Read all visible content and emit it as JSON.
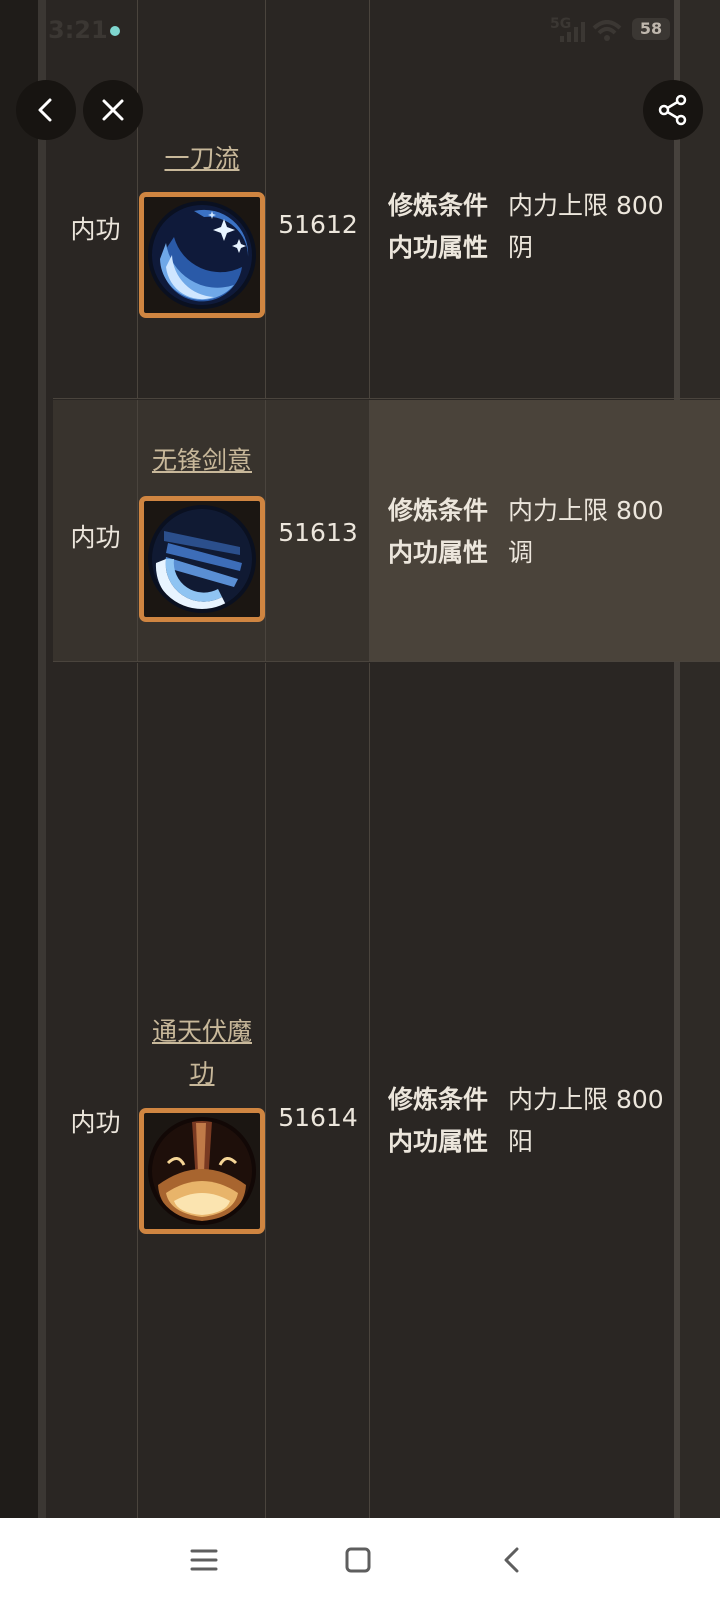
{
  "status_bar": {
    "time": "3:21",
    "network": "5G",
    "battery": "58"
  },
  "top_controls": {
    "back": "back-icon",
    "close": "close-icon",
    "share": "share-icon"
  },
  "rows": [
    {
      "type": "内功",
      "name": "一刀流",
      "id": "51612",
      "attrs": [
        {
          "key": "修炼条件",
          "value": "内力上限 800"
        },
        {
          "key": "内功属性",
          "value": "阴"
        }
      ]
    },
    {
      "type": "内功",
      "name": "无锋剑意",
      "id": "51613",
      "attrs": [
        {
          "key": "修炼条件",
          "value": "内力上限 800"
        },
        {
          "key": "内功属性",
          "value": "调"
        }
      ]
    },
    {
      "type": "内功",
      "name_line1": "通天伏魔",
      "name_line2": "功",
      "id": "51614",
      "attrs": [
        {
          "key": "修炼条件",
          "value": "内力上限 800"
        },
        {
          "key": "内功属性",
          "value": "阳"
        }
      ]
    }
  ],
  "nav": {
    "recents": "menu-icon",
    "home": "home-icon",
    "back": "back-icon"
  }
}
